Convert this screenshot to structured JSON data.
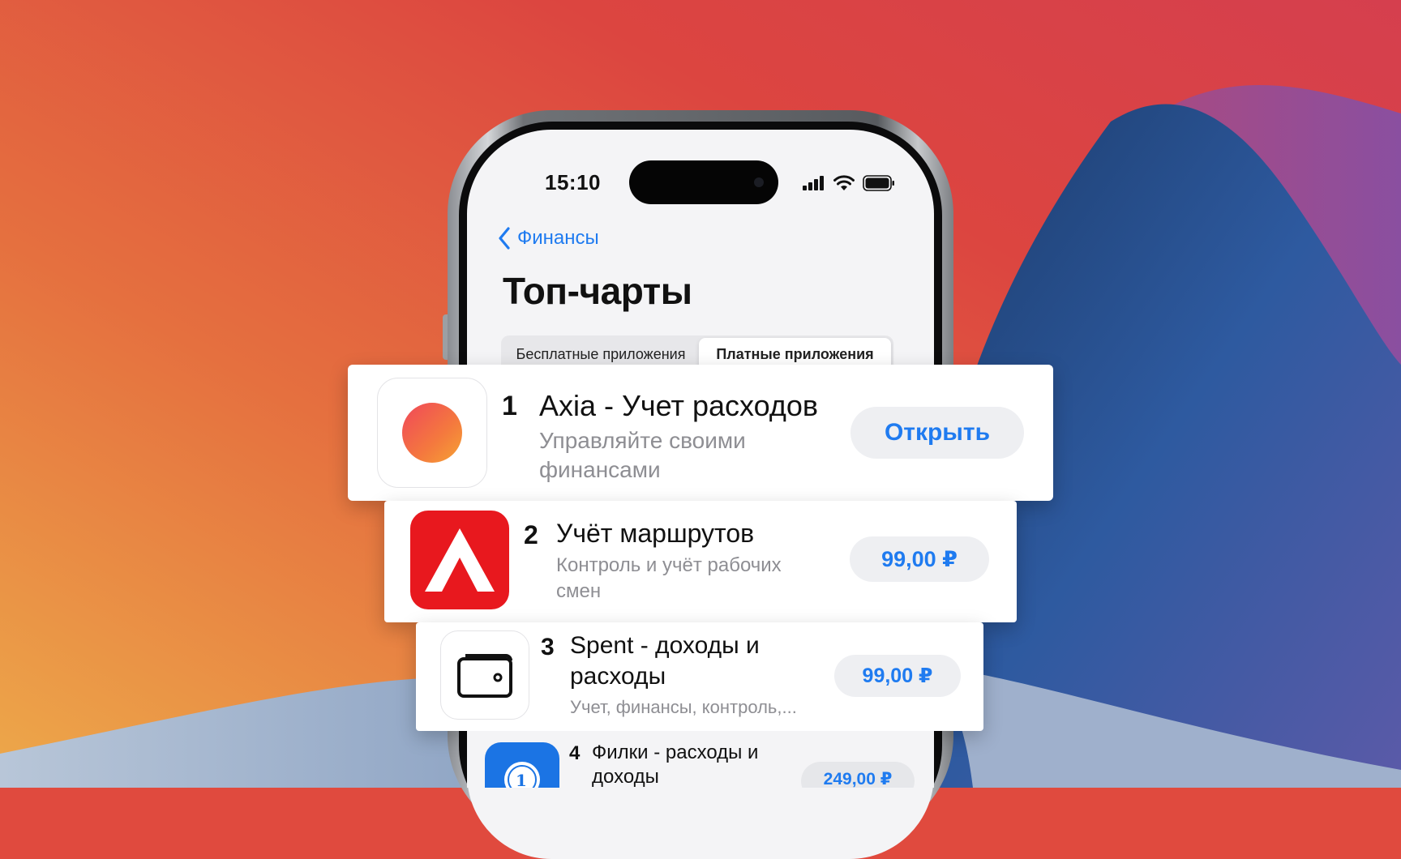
{
  "status_bar": {
    "time": "15:10"
  },
  "nav": {
    "back_label": "Финансы",
    "title": "Топ-чарты"
  },
  "segments": {
    "free": "Бесплатные приложения",
    "paid": "Платные приложения",
    "selected": "paid"
  },
  "apps": [
    {
      "rank": "1",
      "name": "Axia - Учет расходов",
      "subtitle": "Управляйте своими финансами",
      "action": "Открыть",
      "icon": "orange-circle-icon"
    },
    {
      "rank": "2",
      "name": "Учёт маршрутов",
      "subtitle": "Контроль и учёт рабочих смен",
      "action": "99,00 ₽",
      "icon": "red-lambda-icon"
    },
    {
      "rank": "3",
      "name": "Spent - доходы и расходы",
      "subtitle": "Учет, финансы, контроль,...",
      "action": "99,00 ₽",
      "icon": "wallet-icon"
    },
    {
      "rank": "4",
      "name": "Филки - расходы и доходы",
      "subtitle": "",
      "action": "249,00 ₽",
      "icon": "coin-globe-icon"
    }
  ],
  "colors": {
    "accent": "#1f7bf0",
    "app2_red": "#e8181e",
    "app4_blue": "#1b74e4"
  }
}
